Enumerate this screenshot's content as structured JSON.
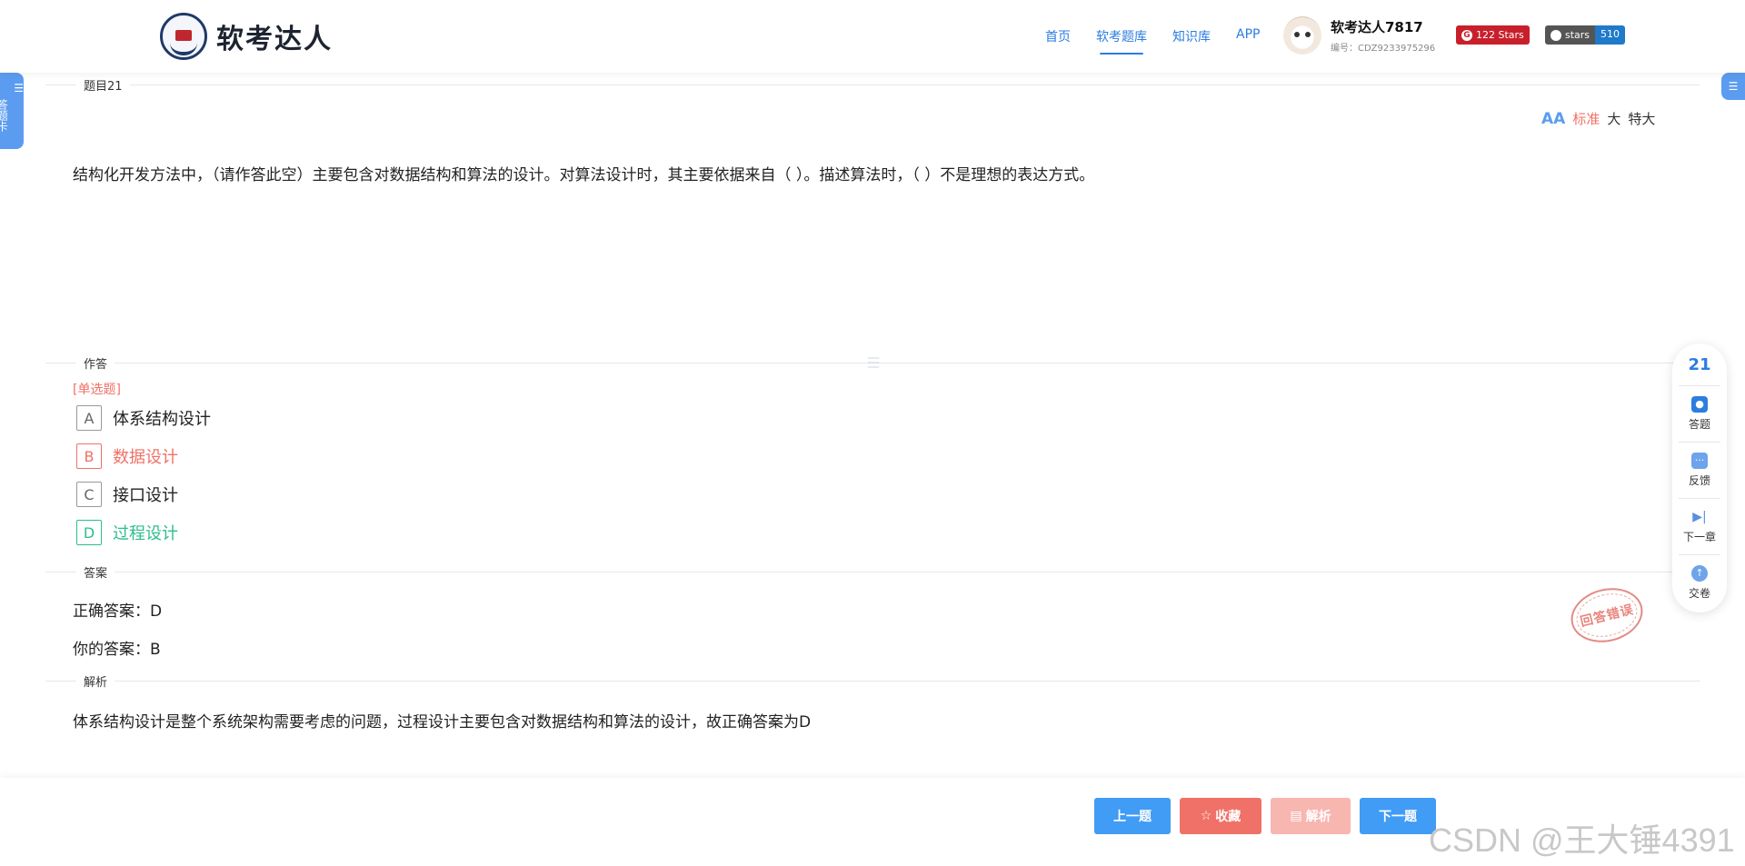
{
  "header": {
    "logo_text": "软考达人",
    "nav": [
      "首页",
      "软考题库",
      "知识库",
      "APP"
    ],
    "active_nav": "软考题库",
    "user_name": "软考达人7817",
    "user_id": "编号：CDZ9233975296",
    "badge_gitee": {
      "label": "122 Stars"
    },
    "badge_github": {
      "label": "stars",
      "count": "510"
    }
  },
  "sidebar_left": {
    "label": "答题卡"
  },
  "question": {
    "section_title": "题目21",
    "text": "结构化开发方法中，（请作答此空）主要包含对数据结构和算法的设计。对算法设计时，其主要依据来自（ ）。描述算法时，（ ）不是理想的表达方式。",
    "font_size_options": [
      "标准",
      "大",
      "特大"
    ],
    "font_size_selected": "标准"
  },
  "answer_area": {
    "section_title": "作答",
    "type_label": "[单选题]",
    "options": [
      {
        "letter": "A",
        "text": "体系结构设计",
        "state": "normal"
      },
      {
        "letter": "B",
        "text": "数据设计",
        "state": "wrong"
      },
      {
        "letter": "C",
        "text": "接口设计",
        "state": "normal"
      },
      {
        "letter": "D",
        "text": "过程设计",
        "state": "correct"
      }
    ]
  },
  "result": {
    "section_title": "答案",
    "correct_answer": "正确答案：D",
    "your_answer": "你的答案：B",
    "stamp_text": "回答错误"
  },
  "analysis": {
    "section_title": "解析",
    "text": "体系结构设计是整个系统架构需要考虑的问题，过程设计主要包含对数据结构和算法的设计，故正确答案为D"
  },
  "float_panel": {
    "current_number": "21",
    "items": [
      "答题",
      "反馈",
      "下一章",
      "交卷"
    ]
  },
  "footer": {
    "prev": "上一题",
    "favorite": "收藏",
    "analysis": "解析",
    "next": "下一题"
  },
  "watermark": "CSDN @王大锤4391",
  "colors": {
    "primary": "#409cf5",
    "danger": "#f07167",
    "success": "#2dbd8f"
  }
}
